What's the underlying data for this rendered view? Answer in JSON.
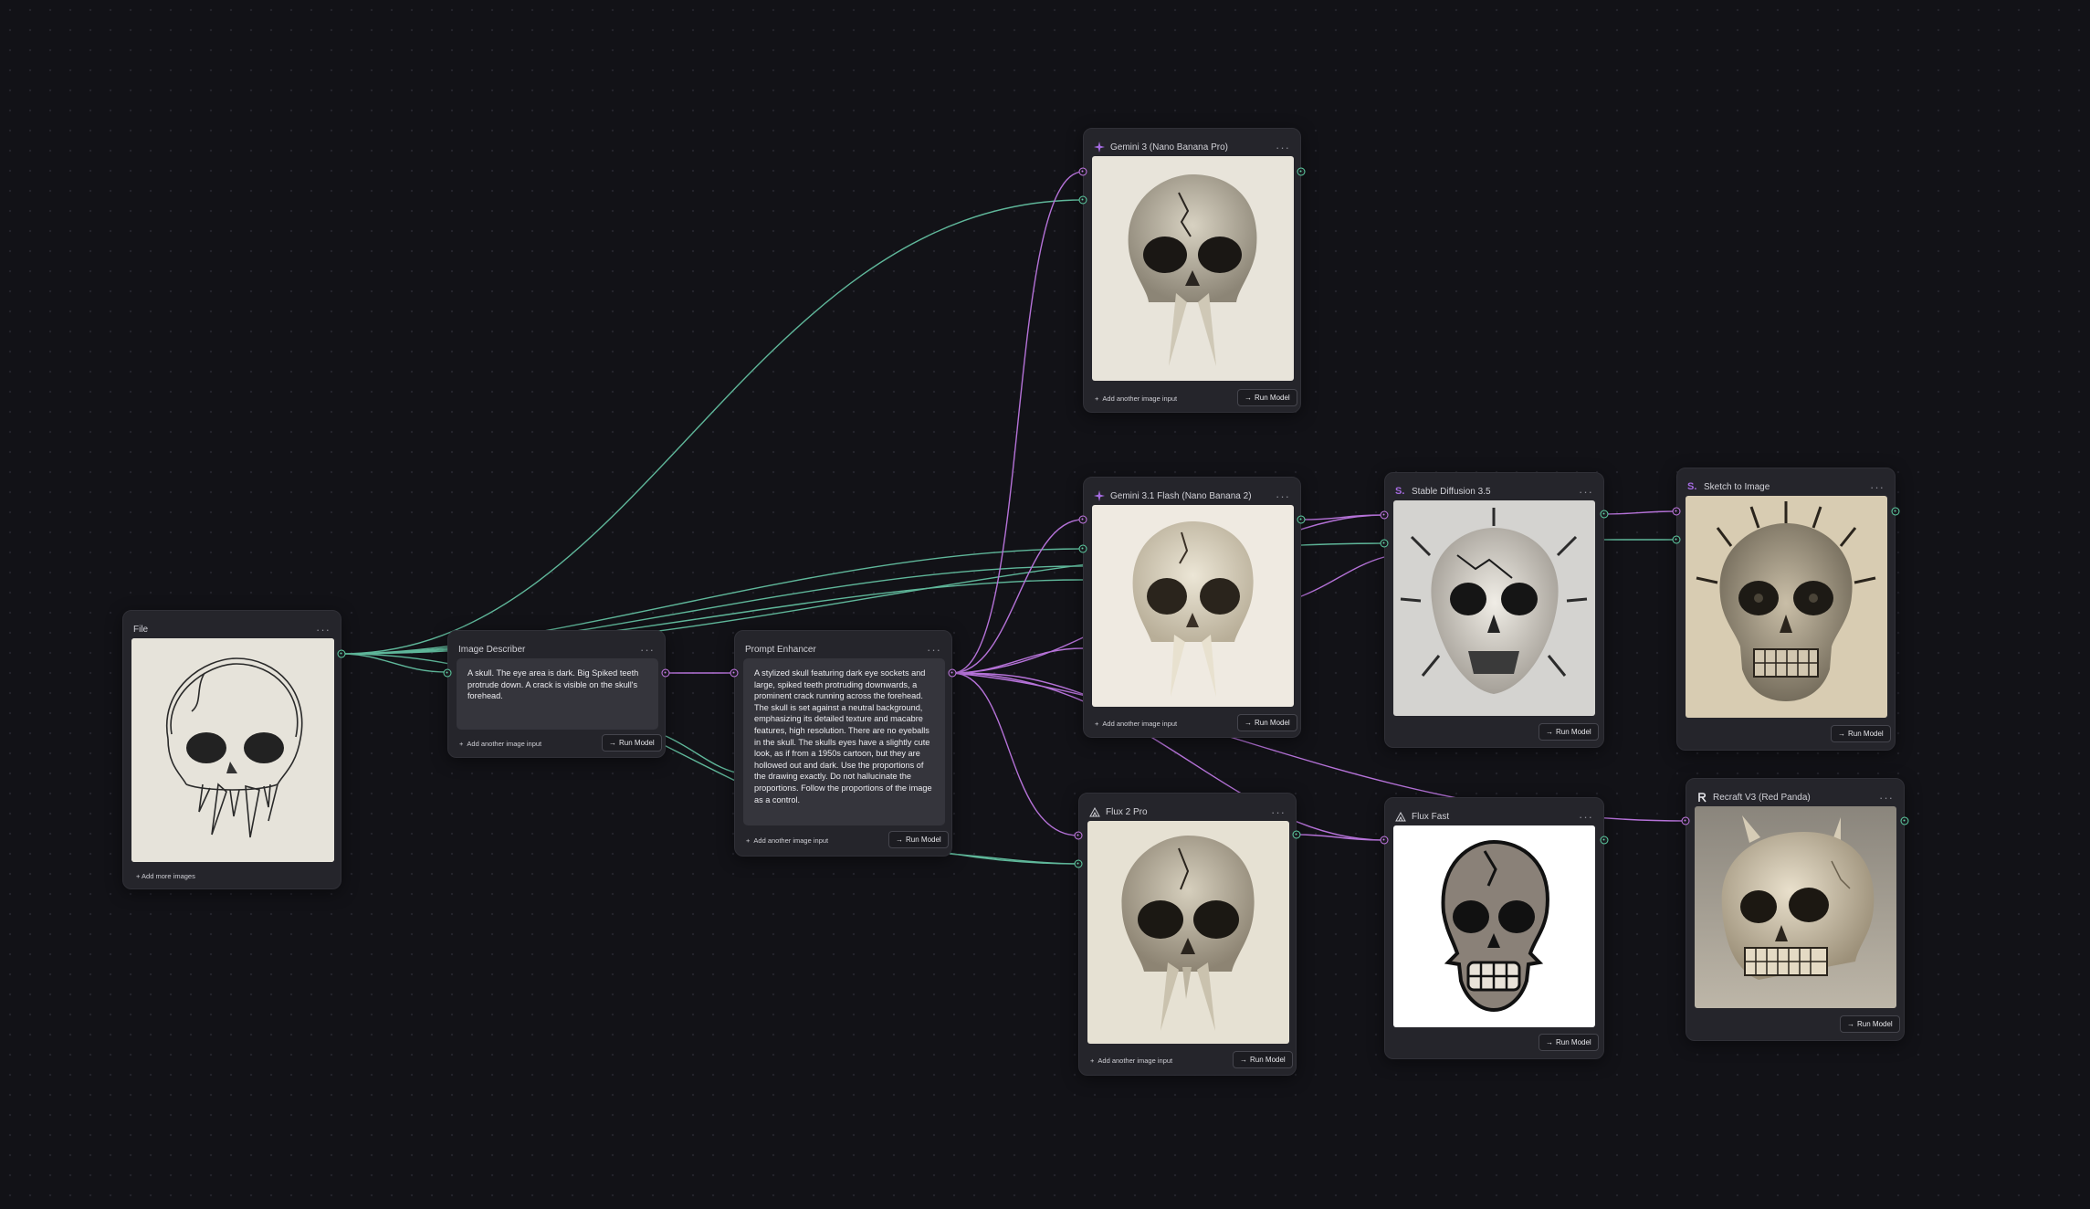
{
  "colors": {
    "background": "#121217",
    "node_bg": "#25252b",
    "image_wire": "#5fb79a",
    "text_wire": "#b572d8",
    "accent_purple": "#a56be0"
  },
  "nodes": {
    "file": {
      "title": "File",
      "menu": "···",
      "add_label": "+ Add more images"
    },
    "image_describer": {
      "title": "Image Describer",
      "menu": "···",
      "text": "A skull. The eye area is dark. Big Spiked teeth protrude down. A crack is visible on the skull's forehead.",
      "add_label": "Add another image input",
      "run_label": "Run Model"
    },
    "prompt_enhancer": {
      "title": "Prompt Enhancer",
      "menu": "···",
      "text": "A stylized skull featuring dark eye sockets and large, spiked teeth protruding downwards, a prominent crack running across the forehead. The skull is set against a neutral background, emphasizing its detailed texture and macabre features, high resolution. There are no eyeballs in the skull. The skulls eyes have a slightly cute look, as if from a 1950s cartoon, but they are hollowed out and dark. Use the proportions of the drawing exactly. Do not hallucinate the proportions. Follow the proportions of the image as a control.",
      "add_label": "Add another image input",
      "run_label": "Run Model"
    },
    "gemini3": {
      "title": "Gemini 3 (Nano Banana Pro)",
      "menu": "···",
      "icon": "sparkle-icon",
      "add_label": "Add another image input",
      "run_label": "Run Model"
    },
    "gemini31": {
      "title": "Gemini 3.1 Flash (Nano Banana 2)",
      "menu": "···",
      "icon": "sparkle-icon",
      "add_label": "Add another image input",
      "run_label": "Run Model"
    },
    "flux2pro": {
      "title": "Flux 2 Pro",
      "menu": "···",
      "icon": "triangle-logo-icon",
      "add_label": "Add another image input",
      "run_label": "Run Model"
    },
    "sd35": {
      "title": "Stable Diffusion 3.5",
      "menu": "···",
      "icon": "stability-logo-icon",
      "run_label": "Run Model"
    },
    "flux_fast": {
      "title": "Flux Fast",
      "menu": "···",
      "icon": "triangle-logo-icon",
      "run_label": "Run Model"
    },
    "sketch_to_image": {
      "title": "Sketch to Image",
      "menu": "···",
      "icon": "stability-logo-icon",
      "run_label": "Run Model"
    },
    "recraft": {
      "title": "Recraft V3 (Red Panda)",
      "menu": "···",
      "icon": "recraft-logo-icon",
      "run_label": "Run Model"
    }
  }
}
